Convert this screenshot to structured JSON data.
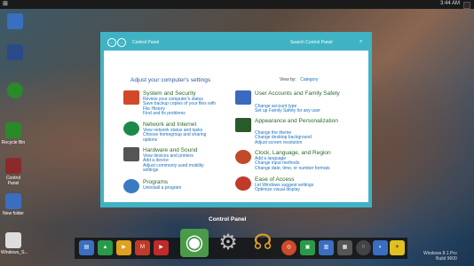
{
  "topbar": {
    "start_glyph": "⊞",
    "clock": "3:44 AM"
  },
  "desktop": {
    "icons": [
      {
        "label": "",
        "color": "#3a6ec0"
      },
      {
        "label": "",
        "color": "#2a4a8a"
      },
      {
        "label": "",
        "color": "#2a8a2a"
      },
      {
        "label": "Recycle Bin",
        "color": "#2a8a2a"
      },
      {
        "label": "Control Panel",
        "color": "#8a2a2a"
      },
      {
        "label": "New folder",
        "color": "#3a6ec0"
      },
      {
        "label": "Windows_S...",
        "color": "#ddd"
      }
    ]
  },
  "control_panel": {
    "breadcrumb": "Control Panel",
    "search_placeholder": "Search Control Panel",
    "heading": "Adjust your computer's settings",
    "view_by_label": "View by:",
    "view_by_value": "Category",
    "categories_left": [
      {
        "title": "System and Security",
        "links": [
          "Review your computer's status",
          "Save backup copies of your files with",
          "File History",
          "Find and fix problems"
        ],
        "icon_color": "#d04a2a"
      },
      {
        "title": "Network and Internet",
        "links": [
          "View network status and tasks",
          "Choose homegroup and sharing",
          "options"
        ],
        "icon_color": "#1a8a4a"
      },
      {
        "title": "Hardware and Sound",
        "links": [
          "View devices and printers",
          "Add a device",
          "Adjust commonly used mobility",
          "settings"
        ],
        "icon_color": "#555555"
      },
      {
        "title": "Programs",
        "links": [
          "Uninstall a program"
        ],
        "icon_color": "#3a7ac0"
      }
    ],
    "categories_right": [
      {
        "title": "User Accounts and Family Safety",
        "links": [
          "Change account type",
          "Set up Family Safety for any user"
        ],
        "icon_color": "#3a6ac0"
      },
      {
        "title": "Appearance and Personalization",
        "links": [
          "Change the theme",
          "Change desktop background",
          "Adjust screen resolution"
        ],
        "icon_color": "#2a5a2a"
      },
      {
        "title": "Clock, Language, and Region",
        "links": [
          "Add a language",
          "Change input methods",
          "Change date, time, or number formats"
        ],
        "icon_color": "#c04a2a"
      },
      {
        "title": "Ease of Access",
        "links": [
          "Let Windows suggest settings",
          "Optimize visual display"
        ],
        "icon_color": "#c03a2a"
      }
    ]
  },
  "window_label": "Control Panel",
  "dock": {
    "icons": [
      {
        "glyph": "▤",
        "color": "#3a6ec0"
      },
      {
        "glyph": "▲",
        "color": "#2a9a4a"
      },
      {
        "glyph": "▶",
        "color": "#e0a020"
      },
      {
        "glyph": "M",
        "color": "#c03a2a"
      },
      {
        "glyph": "▶",
        "color": "#c02a2a"
      },
      {
        "glyph": "◉",
        "color": "#4a9a4a"
      },
      {
        "glyph": "⚙",
        "color": "#888888"
      },
      {
        "glyph": "☊",
        "color": "#e0a020"
      },
      {
        "glyph": "◎",
        "color": "#d04a2a"
      },
      {
        "glyph": "▣",
        "color": "#2a9a4a"
      },
      {
        "glyph": "▥",
        "color": "#3a6ec0"
      },
      {
        "glyph": "▦",
        "color": "#555555"
      },
      {
        "glyph": "⁙",
        "color": "#444444"
      },
      {
        "glyph": "◐",
        "color": "#3a6ec0"
      },
      {
        "glyph": "☀",
        "color": "#e0c020"
      }
    ]
  },
  "watermark": {
    "line1": "Windows 8.1 Pro",
    "line2": "Build 9600"
  }
}
